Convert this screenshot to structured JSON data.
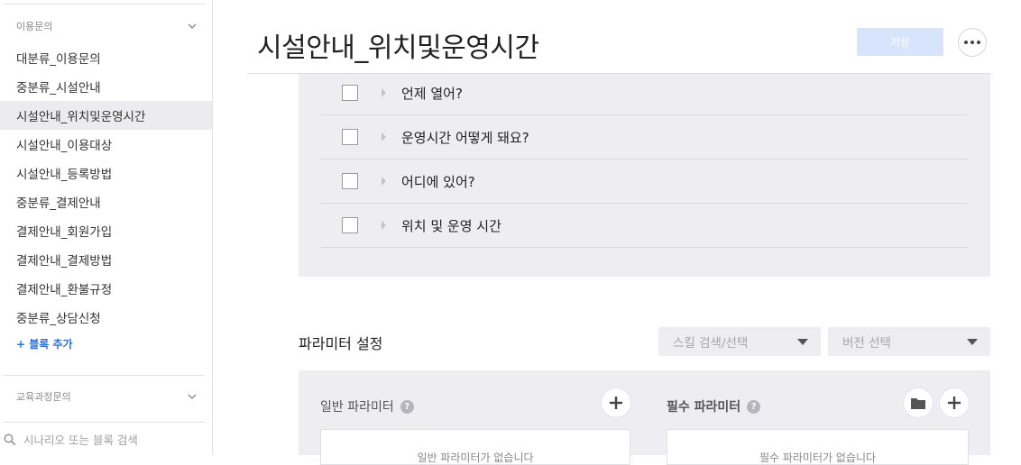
{
  "sidebar": {
    "group1_title": "이용문의",
    "items": [
      {
        "label": "대분류_이용문의"
      },
      {
        "label": "중분류_시설안내"
      },
      {
        "label": "시설안내_위치및운영시간"
      },
      {
        "label": "시설안내_이용대상"
      },
      {
        "label": "시설안내_등록방법"
      },
      {
        "label": "중분류_결제안내"
      },
      {
        "label": "결제안내_회원가입"
      },
      {
        "label": "결제안내_결제방법"
      },
      {
        "label": "결제안내_환불규정"
      },
      {
        "label": "중분류_상담신청"
      }
    ],
    "add_block": "+ 블록 추가",
    "group2_title": "교육과정문의",
    "search_placeholder": "시나리오 또는 블록 검색"
  },
  "header": {
    "title": "시설안내_위치및운영시간",
    "save_label": "저장"
  },
  "utterances": [
    {
      "text": "언제 열어?"
    },
    {
      "text": "운영시간 어떻게 돼요?"
    },
    {
      "text": "어디에 있어?"
    },
    {
      "text": "위치 및 운영 시간"
    }
  ],
  "params": {
    "title": "파라미터 설정",
    "skill_select": "스킬 검색/선택",
    "version_select": "버전 선택",
    "general_label": "일반 파라미터",
    "required_label": "필수 파라미터",
    "general_empty": "일반 파라미터가 없습니다",
    "required_empty": "필수 파라미터가 없습니다"
  },
  "icons": {
    "chevron": "chevron-down-icon",
    "search": "search-icon",
    "more": "more-horizontal-icon",
    "plus": "plus-icon",
    "folder": "folder-icon",
    "help": "help-icon"
  }
}
